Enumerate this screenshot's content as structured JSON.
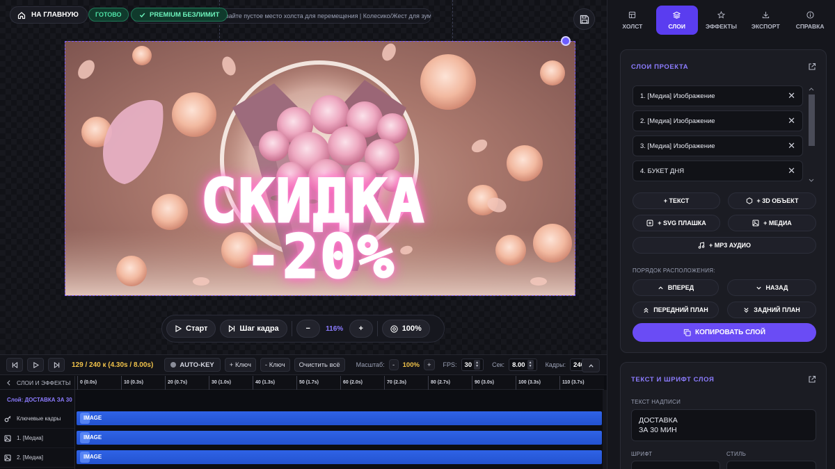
{
  "topbar": {
    "home_label": "НА ГЛАВНУЮ",
    "ready_badge": "ГОТОВО",
    "premium_badge": "PREMIUM БЕЗЛИМИТ",
    "hint": "живайте пустое место холста для перемещения | Колесико/Жест для зума"
  },
  "canvas": {
    "title_line1": "СКИДКА",
    "title_line2": "-20%"
  },
  "playbar": {
    "start_label": "Старт",
    "step_label": "Шаг кадра",
    "minus": "−",
    "zoom": "116%",
    "plus": "+",
    "fit_label": "100%"
  },
  "timeline": {
    "frame_counter": "129 / 240 к (4.30s / 8.00s)",
    "autokey_label": "AUTO-KEY",
    "add_key_label": "+ Ключ",
    "remove_key_label": "- Ключ",
    "clear_label": "Очистить всё",
    "scale_label": "Масштаб:",
    "scale_minus": "-",
    "scale_value": "100%",
    "scale_plus": "+",
    "fps_label": "FPS:",
    "fps_value": "30",
    "sec_label": "Сек:",
    "sec_value": "8.00",
    "frames_label": "Кадры:",
    "frames_value": "240",
    "side_header": "СЛОИ И ЭФФЕКТЫ",
    "current_layer": "Слой: ДОСТАВКА ЗА 30",
    "ruler": [
      "0 (0.0s)",
      "10 (0.3s)",
      "20 (0.7s)",
      "30 (1.0s)",
      "40 (1.3s)",
      "50 (1.7s)",
      "60 (2.0s)",
      "70 (2.3s)",
      "80 (2.7s)",
      "90 (3.0s)",
      "100 (3.3s)",
      "110 (3.7s)"
    ],
    "rows": [
      {
        "label": "Ключевые кадры",
        "track": "IMAGE"
      },
      {
        "label": "1. [Медиа]",
        "track": "IMAGE"
      },
      {
        "label": "2. [Медиа]",
        "track": "IMAGE"
      }
    ]
  },
  "panel": {
    "tabs": [
      {
        "label": "ХОЛСТ",
        "icon": "canvas-icon"
      },
      {
        "label": "СЛОИ",
        "icon": "layers-icon"
      },
      {
        "label": "ЭФФЕКТЫ",
        "icon": "star-icon"
      },
      {
        "label": "ЭКСПОРТ",
        "icon": "download-icon"
      },
      {
        "label": "СПРАВКА",
        "icon": "info-icon"
      }
    ],
    "layers_title": "СЛОИ ПРОЕКТА",
    "layers": [
      "1. [Медиа] Изображение",
      "2. [Медиа] Изображение",
      "3. [Медиа] Изображение",
      "4. БУКЕТ ДНЯ"
    ],
    "add_text": "+ ТЕКСТ",
    "add_3d": "+ 3D ОБЪЕКТ",
    "add_svg": "+ SVG ПЛАШКА",
    "add_media": "+ МЕДИА",
    "add_audio": "+ MP3 АУДИО",
    "order_label": "ПОРЯДОК РАСПОЛОЖЕНИЯ:",
    "forward": "ВПЕРЕД",
    "backward": "НАЗАД",
    "to_front": "ПЕРЕДНИЙ ПЛАН",
    "to_back": "ЗАДНИЙ ПЛАН",
    "copy_layer": "КОПИРОВАТЬ СЛОЙ",
    "text_card_title": "ТЕКСТ И ШРИФТ СЛОЯ",
    "text_label": "ТЕКСТ НАДПИСИ",
    "text_value": "ДОСТАВКА\nЗА 30 МИН",
    "font_label": "ШРИФТ",
    "style_label": "СТИЛЬ"
  },
  "colors": {
    "accent": "#6a4cf5",
    "accent_text": "#8c7cff",
    "track": "#2f63e6",
    "success": "#4ee2a6",
    "frame_counter": "#f0c24a"
  }
}
